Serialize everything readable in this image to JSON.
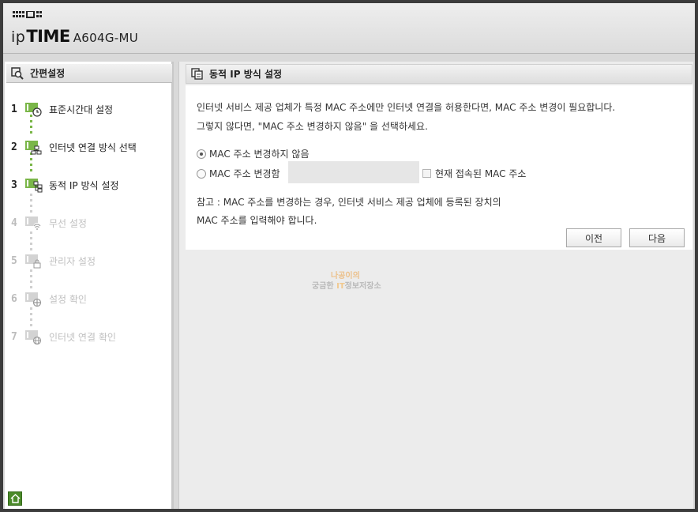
{
  "header": {
    "brand_prefix": "ip",
    "brand_name": "TIME",
    "model": "A604G-MU"
  },
  "sidebar": {
    "title": "간편설정",
    "steps": [
      {
        "num": "1",
        "label": "표준시간대 설정",
        "icon": "clock-icon",
        "enabled": true
      },
      {
        "num": "2",
        "label": "인터넷 연결 방식 선택",
        "icon": "network-icon",
        "enabled": true
      },
      {
        "num": "3",
        "label": "동적 IP 방식 설정",
        "icon": "tree-network-icon",
        "enabled": true
      },
      {
        "num": "4",
        "label": "무선 설정",
        "icon": "wifi-icon",
        "enabled": false
      },
      {
        "num": "5",
        "label": "관리자 설정",
        "icon": "lock-icon",
        "enabled": false
      },
      {
        "num": "6",
        "label": "설정 확인",
        "icon": "check-gear-icon",
        "enabled": false
      },
      {
        "num": "7",
        "label": "인터넷 연결 확인",
        "icon": "globe-icon",
        "enabled": false
      }
    ],
    "home_icon": "home-icon"
  },
  "panel": {
    "title": "동적 IP 방식 설정",
    "desc_line1": "인터넷 서비스 제공 업체가 특정 MAC 주소에만 인터넷 연결을 허용한다면, MAC 주소 변경이 필요합니다.",
    "desc_line2": "그렇지 않다면, \"MAC 주소 변경하지 않음\" 을 선택하세요.",
    "option_no_change": "MAC 주소 변경하지 않음",
    "option_change": "MAC 주소 변경함",
    "mac_value": "",
    "current_mac_label": "현재 접속된 MAC 주소",
    "note_line1": "참고 : MAC 주소를 변경하는 경우, 인터넷 서비스 제공 업체에 등록된 장치의",
    "note_line2": "MAC 주소를 입력해야 합니다.",
    "prev_button": "이전",
    "next_button": "다음"
  },
  "watermark": {
    "line1": "나공이의",
    "line2_a": "궁금한 ",
    "line2_b": "IT",
    "line2_c": "정보저장소"
  },
  "colors": {
    "accent_green": "#7ab648",
    "step_disabled": "#c0c0c0"
  }
}
